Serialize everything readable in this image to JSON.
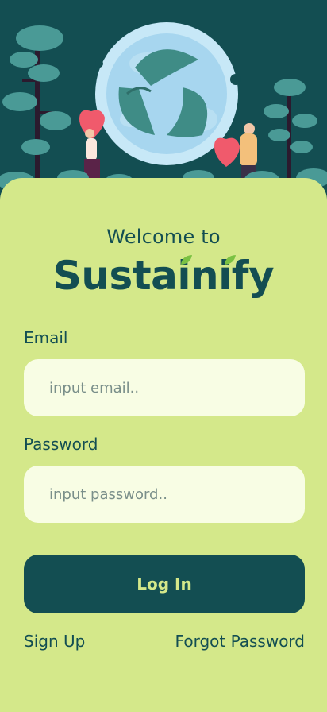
{
  "header": {
    "welcome": "Welcome to",
    "brand": "Sustainify"
  },
  "form": {
    "email_label": "Email",
    "email_placeholder": "input email..",
    "password_label": "Password",
    "password_placeholder": "input password..",
    "login_label": "Log In"
  },
  "links": {
    "signup": "Sign Up",
    "forgot": "Forgot Password"
  },
  "colors": {
    "primary": "#134e52",
    "card": "#d4e88a",
    "field": "#f8fde4",
    "leaf_accent": "#7ac142"
  }
}
